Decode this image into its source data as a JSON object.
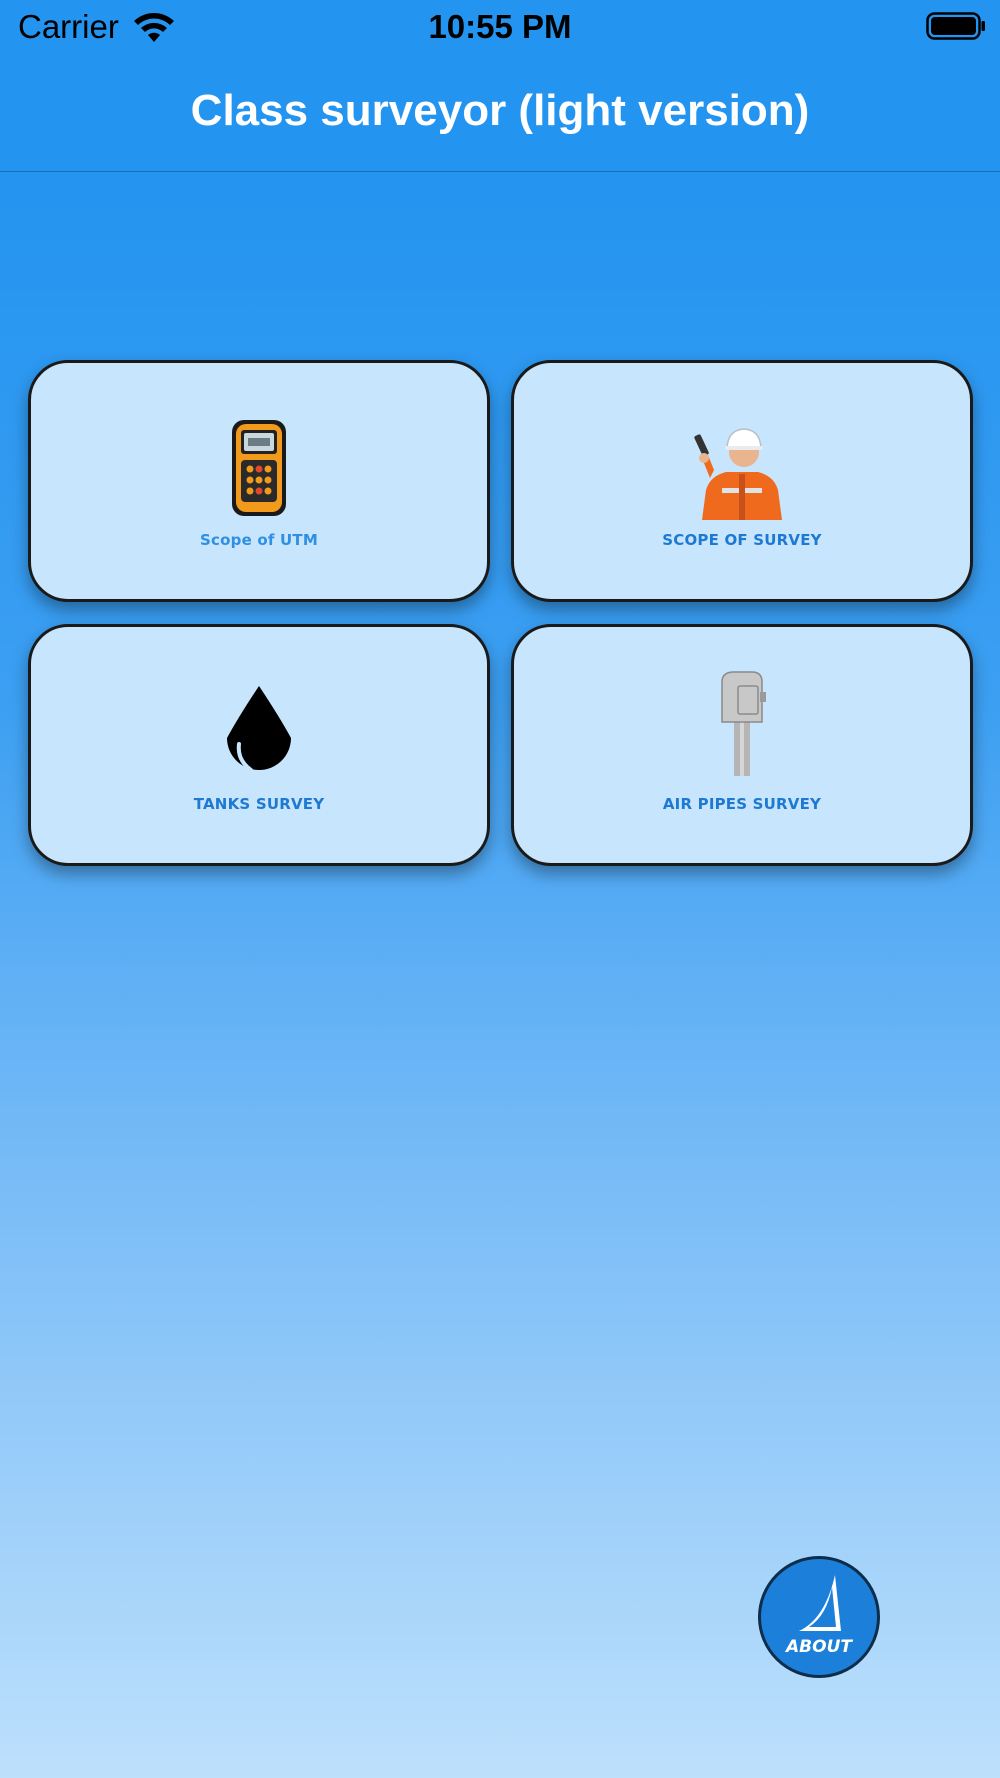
{
  "status_bar": {
    "carrier": "Carrier",
    "time": "10:55 PM",
    "wifi_icon": "wifi-icon",
    "battery_icon": "battery-icon"
  },
  "nav": {
    "title": "Class surveyor (light version)"
  },
  "tiles": [
    {
      "label": "Scope of UTM",
      "icon": "thickness-gauge-icon"
    },
    {
      "label": "SCOPE OF SURVEY",
      "icon": "surveyor-icon"
    },
    {
      "label": "TANKS SURVEY",
      "icon": "oil-drop-icon"
    },
    {
      "label": "AIR PIPES SURVEY",
      "icon": "air-pipe-head-icon"
    }
  ],
  "about": {
    "label": "ABOUT",
    "icon": "about-logo-icon"
  },
  "colors": {
    "nav_background": "#2394f0",
    "tile_background": "#c7e5fd",
    "tile_label": "#1d79d2",
    "about_button": "#1c7fd9"
  }
}
